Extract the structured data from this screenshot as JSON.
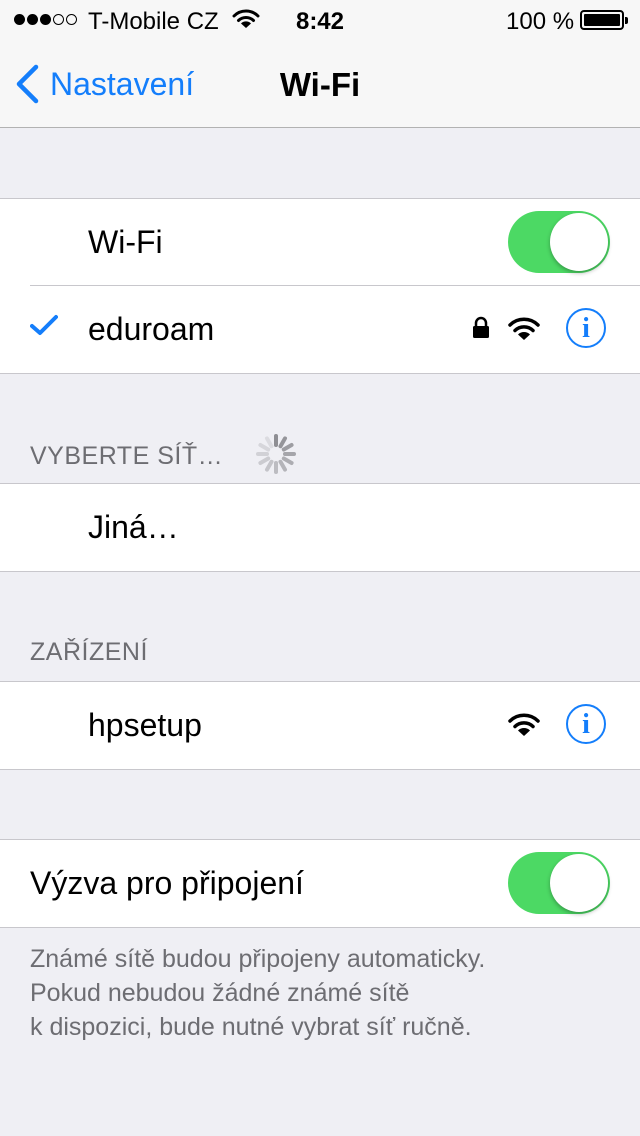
{
  "status_bar": {
    "carrier": "T-Mobile CZ",
    "time": "8:42",
    "battery": "100 %"
  },
  "nav": {
    "back_label": "Nastavení",
    "title": "Wi-Fi"
  },
  "wifi_group": {
    "toggle_label": "Wi-Fi",
    "toggle_on": true,
    "connected_network": "eduroam",
    "connected_secured": true
  },
  "choose_section": {
    "header": "VYBERTE SÍŤ…",
    "other_label": "Jiná…"
  },
  "devices_section": {
    "header": "ZAŘÍZENÍ",
    "networks": [
      {
        "name": "hpsetup",
        "secured": false
      }
    ]
  },
  "ask_group": {
    "label": "Výzva pro připojení",
    "toggle_on": true
  },
  "footer": {
    "lines": [
      "Známé sítě budou připojeny automaticky.",
      "Pokud nebudou žádné známé sítě",
      "k dispozici, bude nutné vybrat síť ručně."
    ]
  },
  "icons": {
    "info": "i",
    "accent_color": "#147efb",
    "switch_color": "#4cd964"
  }
}
